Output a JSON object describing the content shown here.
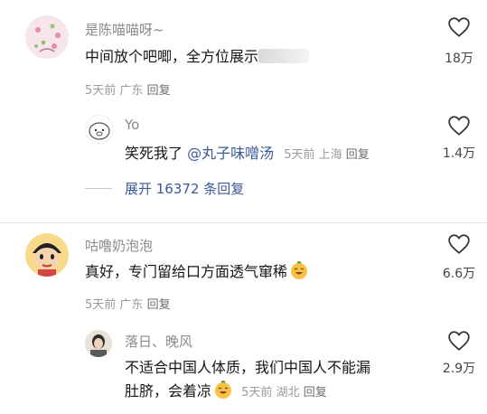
{
  "comments": [
    {
      "user": "是陈喵喵呀~",
      "text": "中间放个吧唧，全方位展示",
      "time": "5天前",
      "location": "广东",
      "reply_label": "回复",
      "likes": "18万",
      "replies": [
        {
          "user": "Yo",
          "text_before": "笑死我了 ",
          "mention": "@丸子味噌汤",
          "time": "5天前",
          "location": "上海",
          "reply_label": "回复",
          "likes": "1.4万"
        }
      ],
      "expand_label": "展开 16372 条回复"
    },
    {
      "user": "咕噜奶泡泡",
      "text": "真好，专门留给口方面透气窜稀",
      "time": "5天前",
      "location": "广东",
      "reply_label": "回复",
      "likes": "6.6万",
      "replies": [
        {
          "user": "落日、晚风",
          "text_line1": "不适合中国人体质，我们中国人不能漏",
          "text_line2": "肚脐，会着凉",
          "time": "5天前",
          "location": "湖北",
          "reply_label": "回复",
          "likes": "2.9万"
        }
      ]
    }
  ]
}
